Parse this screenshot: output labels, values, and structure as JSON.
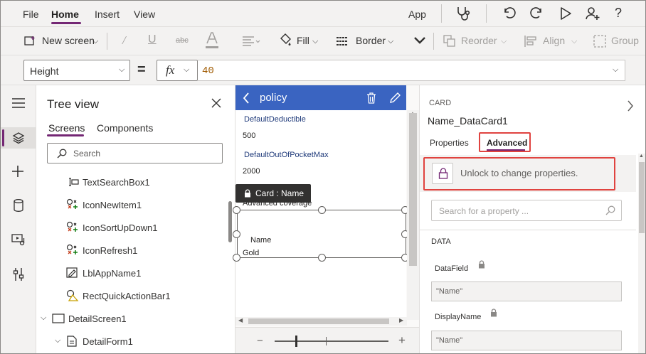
{
  "menu": {
    "file": "File",
    "home": "Home",
    "insert": "Insert",
    "view": "View",
    "app": "App"
  },
  "toolbar": {
    "new_screen": "New screen",
    "fill": "Fill",
    "border": "Border",
    "reorder": "Reorder",
    "align": "Align",
    "group": "Group"
  },
  "formula": {
    "property": "Height",
    "equals": "=",
    "fx": "fx",
    "value": "40"
  },
  "tree": {
    "title": "Tree view",
    "tab_screens": "Screens",
    "tab_components": "Components",
    "search_placeholder": "Search",
    "items": [
      {
        "label": "TextSearchBox1",
        "icon": "textbox-icon"
      },
      {
        "label": "IconNewItem1",
        "icon": "icon-control-icon"
      },
      {
        "label": "IconSortUpDown1",
        "icon": "icon-control-icon"
      },
      {
        "label": "IconRefresh1",
        "icon": "icon-control-icon"
      },
      {
        "label": "LblAppName1",
        "icon": "label-icon"
      },
      {
        "label": "RectQuickActionBar1",
        "icon": "shape-icon"
      },
      {
        "label": "DetailScreen1",
        "icon": "screen-icon"
      },
      {
        "label": "DetailForm1",
        "icon": "form-icon"
      }
    ]
  },
  "canvas": {
    "header_title": "policy",
    "field1_label": "DefaultDeductible",
    "field1_value": "500",
    "field2_label": "DefaultOutOfPocketMax",
    "field2_value": "2000",
    "tooltip": "Card : Name",
    "field3_label": "Advanced coverage",
    "name_label": "Name",
    "name_value": "Gold",
    "zoom_minus": "−",
    "zoom_plus": "+"
  },
  "panel": {
    "section": "CARD",
    "control_name": "Name_DataCard1",
    "tab_properties": "Properties",
    "tab_advanced": "Advanced",
    "unlock_text": "Unlock to change properties.",
    "search_placeholder": "Search for a property ...",
    "data_section": "DATA",
    "datafield_label": "DataField",
    "datafield_value": "\"Name\"",
    "displayname_label": "DisplayName",
    "displayname_value": "\"Name\""
  },
  "colors": {
    "accent": "#742774",
    "canvas_header": "#3a64c1",
    "highlight": "#e0433f"
  }
}
